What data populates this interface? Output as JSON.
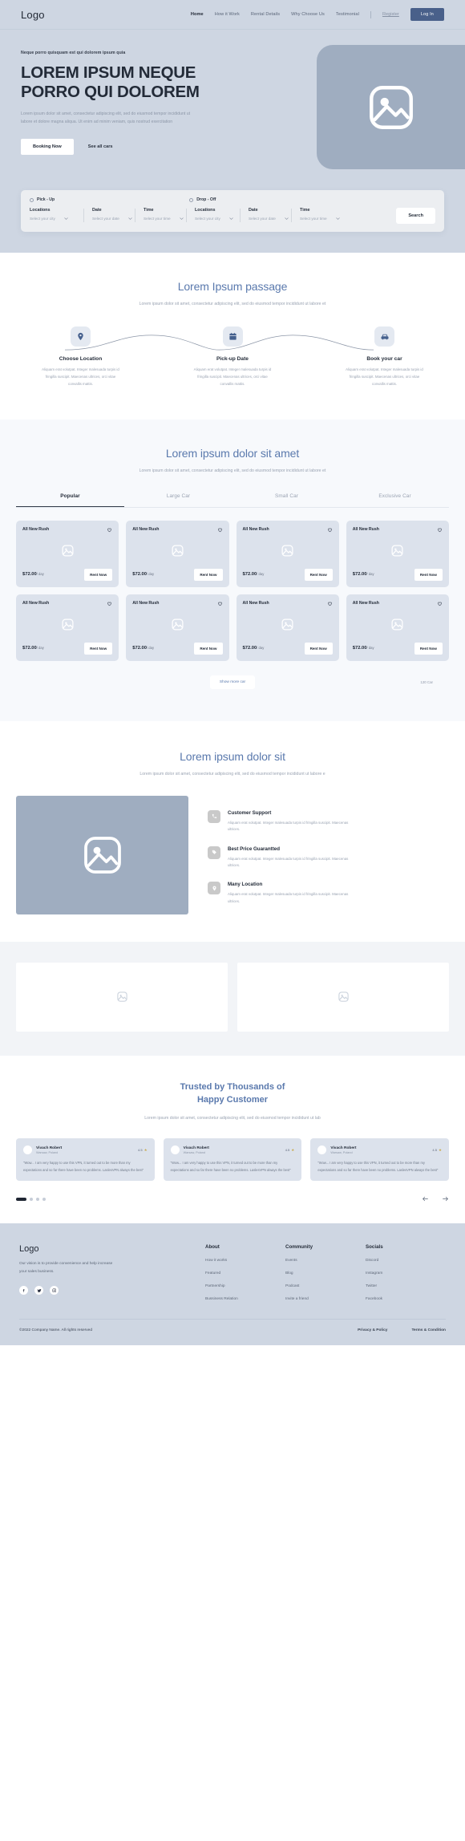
{
  "nav": {
    "logo": "Logo",
    "links": [
      {
        "label": "Home",
        "active": true
      },
      {
        "label": "How it Work",
        "active": false
      },
      {
        "label": "Rental Details",
        "active": false
      },
      {
        "label": "Why Choose Us",
        "active": false
      },
      {
        "label": "Testimonial",
        "active": false
      }
    ],
    "register": "Register",
    "login": "Log In"
  },
  "hero": {
    "eyebrow": "Neque porro quisquam est qui dolorem ipsum quia",
    "title_line1": "LOREM IPSUM NEQUE",
    "title_line2": "PORRO QUI DOLOREM",
    "subtitle": "Lorem ipsum dolor sit amet, consectetur adipiscing elit, sed do eiusmod tempor incididunt ut labore et dolore magna aliqua. Ut enim ad minim veniam, quis nostrud exercitation",
    "primary_button": "Booking Now",
    "secondary_button": "See all cars",
    "art_icon": "image-placeholder-icon"
  },
  "search": {
    "pickup_label": "Pick - Up",
    "dropoff_label": "Drop - Off",
    "fields": [
      {
        "label": "Locations",
        "value": "Select your city"
      },
      {
        "label": "Date",
        "value": "Select your date"
      },
      {
        "label": "Time",
        "value": "Select your time"
      },
      {
        "label": "Locations",
        "value": "Select your city"
      },
      {
        "label": "Date",
        "value": "Select your date"
      },
      {
        "label": "Time",
        "value": "Select your time"
      }
    ],
    "search_button": "Search"
  },
  "passage": {
    "title": "Lorem Ipsum passage",
    "subtitle": "Lorem ipsum dolor sit amet, consectetur adipiscing elit, sed do eiusmod tempor incididunt ut labore et",
    "steps": [
      {
        "icon": "location-pin-icon",
        "title": "Choose Location",
        "desc": "Aliquam erat volutpat. Integer malesuada turpis id fringilla suscipit. Maecenas ultrices, orci vitae convallis mattis."
      },
      {
        "icon": "calendar-icon",
        "title": "Pick-up Date",
        "desc": "Aliquam erat volutpat. Integer malesuada turpis id fringilla suscipit. Maecenas ultrices, orci vitae convallis mattis."
      },
      {
        "icon": "car-icon",
        "title": "Book your car",
        "desc": "Aliquam erat volutpat. Integer malesuada turpis id fringilla suscipit. Maecenas ultrices, orci vitae convallis mattis."
      }
    ]
  },
  "cars": {
    "title": "Lorem ipsum dolor sit amet",
    "subtitle": "Lorem ipsum dolor sit amet, consectetur adipiscing elit, sed do eiusmod tempor incididunt ut labore et",
    "tabs": [
      {
        "label": "Popular",
        "active": true
      },
      {
        "label": "Large Car",
        "active": false
      },
      {
        "label": "Small Car",
        "active": false
      },
      {
        "label": "Exclusive Car",
        "active": false
      }
    ],
    "items": [
      {
        "name": "All New Rush",
        "price": "$72.00",
        "per": "/ day",
        "button": "Rent Now"
      },
      {
        "name": "All New Rush",
        "price": "$72.00",
        "per": "/ day",
        "button": "Rent Now"
      },
      {
        "name": "All New Rush",
        "price": "$72.00",
        "per": "/ day",
        "button": "Rent Now"
      },
      {
        "name": "All New Rush",
        "price": "$72.00",
        "per": "/ day",
        "button": "Rent Now"
      },
      {
        "name": "All New Rush",
        "price": "$72.00",
        "per": "/ day",
        "button": "Rent Now"
      },
      {
        "name": "All New Rush",
        "price": "$72.00",
        "per": "/ day",
        "button": "Rent Now"
      },
      {
        "name": "All New Rush",
        "price": "$72.00",
        "per": "/ day",
        "button": "Rent Now"
      },
      {
        "name": "All New Rush",
        "price": "$72.00",
        "per": "/ day",
        "button": "Rent Now"
      }
    ],
    "show_more": "Show more car",
    "count": "120 Car"
  },
  "why": {
    "title": "Lorem ipsum dolor sit",
    "subtitle": "Lorem ipsum dolor sit amet, consectetur adipiscing elit, sed do eiusmod tempor incididunt ut labore e",
    "art_icon": "image-placeholder-icon",
    "features": [
      {
        "icon": "phone-icon",
        "title": "Customer Support",
        "desc": "Aliquam erat volutpat. Integer malesuada turpis id fringilla suscipit. Maecenas ultrices."
      },
      {
        "icon": "tag-icon",
        "title": "Best Price Guarantted",
        "desc": "Aliquam erat volutpat. Integer malesuada turpis id fringilla suscipit. Maecenas ultrices."
      },
      {
        "icon": "location-pin-icon",
        "title": "Many Location",
        "desc": "Aliquam erat volutpat. Integer malesuada turpis id fringilla suscipit. Maecenas ultrices."
      }
    ]
  },
  "gallery": {
    "cards": [
      {
        "icon": "image-placeholder-icon"
      },
      {
        "icon": "image-placeholder-icon"
      }
    ]
  },
  "testimonials": {
    "title_line1": "Trusted by Thousands of",
    "title_line2": "Happy Customer",
    "subtitle": "Lorem ipsum dolor sit amet, consectetur adipiscing elit, sed do eiusmod tempor incididunt ut lab",
    "items": [
      {
        "name": "Vivach Robert",
        "location": "Warsaw, Poland",
        "rating": "4.5",
        "quote": "\"Wow... I am very happy to use this VPN, it turned out to be more than my expectations and so far there have been no problems. LaslesVPN always the best\""
      },
      {
        "name": "Vivach Robert",
        "location": "Warsaw, Poland",
        "rating": "4.5",
        "quote": "\"Wow... I am very happy to use this VPN, it turned out to be more than my expectations and so far there have been no problems. LaslesVPN always the best\""
      },
      {
        "name": "Vivach Robert",
        "location": "Warsaw, Poland",
        "rating": "4.5",
        "quote": "\"Wow... I am very happy to use this VPN, it turned out to be more than my expectations and so far there have been no problems. LaslesVPN always the best\""
      }
    ],
    "dots": [
      true,
      false,
      false,
      false
    ],
    "prev_icon": "arrow-left-icon",
    "next_icon": "arrow-right-icon"
  },
  "footer": {
    "logo": "Logo",
    "vision": "Our vision is to provide convenience and help increase your sales business.",
    "socials": [
      {
        "icon": "facebook-icon",
        "glyph": "f"
      },
      {
        "icon": "twitter-icon",
        "glyph": "t"
      },
      {
        "icon": "instagram-icon",
        "glyph": "i"
      }
    ],
    "columns": [
      {
        "heading": "About",
        "links": [
          "How it works",
          "Featured",
          "Partnership",
          "Bussiness Relation"
        ]
      },
      {
        "heading": "Community",
        "links": [
          "Events",
          "Blog",
          "Podcast",
          "Invite a friend"
        ]
      },
      {
        "heading": "Socials",
        "links": [
          "Discord",
          "Instagram",
          "Twitter",
          "Facebook"
        ]
      }
    ],
    "copyright": "©2022 Company Name. All rights reserved",
    "legal": [
      "Privacy & Policy",
      "Terms & Condition"
    ]
  }
}
